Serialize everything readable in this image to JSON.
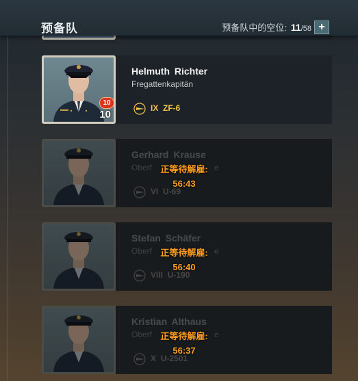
{
  "header": {
    "title": "预备队",
    "slots_label": "预备队中的空位:",
    "slots_used": "11",
    "slots_total": "/58",
    "add_label": "+"
  },
  "commanders": [
    {
      "name": "Helmuth  Richter",
      "rank": "Fregattenkapitän",
      "tier": "IX",
      "ship": "ZF-6",
      "level": "10",
      "points_badge": "10",
      "status": ""
    },
    {
      "name": "Gerhard  Krause",
      "rank": "Oberf",
      "rank_tail": "e",
      "tier": "VI",
      "ship": "U-69",
      "status": "正等待解雇:",
      "timer": "56:43"
    },
    {
      "name": "Stefan  Schäfer",
      "rank": "Oberf",
      "rank_tail": "e",
      "tier": "VIII",
      "ship": "U-190",
      "status": "正等待解雇:",
      "timer": "56:40"
    },
    {
      "name": "Kristian  Althaus",
      "rank": "Oberf",
      "rank_tail": "e",
      "tier": "X",
      "ship": "U-2501",
      "status": "正等待解雇:",
      "timer": "56:37"
    }
  ],
  "colors": {
    "timer": "#ff9e1f",
    "ship_active": "#f2c14a",
    "badge": "#d8371f"
  }
}
